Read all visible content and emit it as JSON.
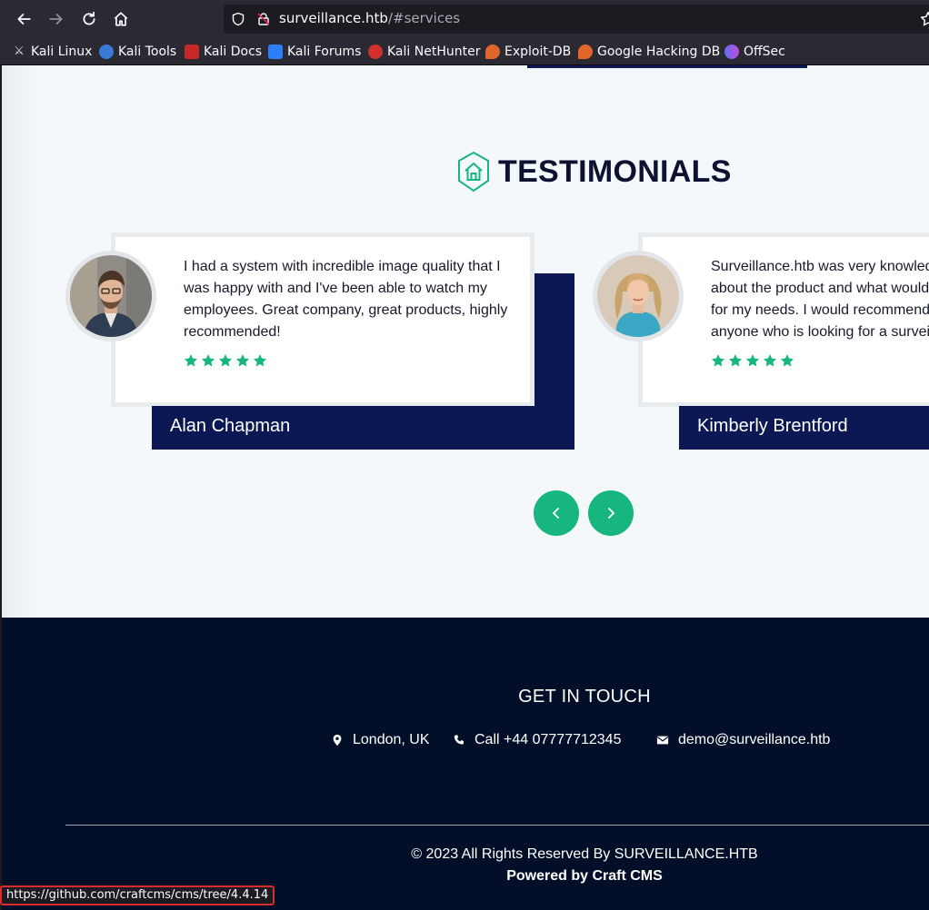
{
  "browser": {
    "url_host": "surveillance.htb",
    "url_path": "/#services",
    "bookmarks": [
      {
        "label": "Kali Linux",
        "icon": "kali-dragon-icon",
        "color": "#1a1a1a"
      },
      {
        "label": "Kali Tools",
        "icon": "kali-tools-icon",
        "color": "#3a7bd5"
      },
      {
        "label": "Kali Docs",
        "icon": "kali-docs-icon",
        "color": "#c62828"
      },
      {
        "label": "Kali Forums",
        "icon": "kali-forums-icon",
        "color": "#2d7ff9"
      },
      {
        "label": "Kali NetHunter",
        "icon": "nethunter-icon",
        "color": "#d32f2f"
      },
      {
        "label": "Exploit-DB",
        "icon": "exploit-db-icon",
        "color": "#e0662c"
      },
      {
        "label": "Google Hacking DB",
        "icon": "ghdb-icon",
        "color": "#e0662c"
      },
      {
        "label": "OffSec",
        "icon": "offsec-icon",
        "color": "#5b6ef5"
      }
    ],
    "status_url": "https://github.com/craftcms/cms/tree/4.4.14"
  },
  "testimonials": {
    "title": "TESTIMONIALS",
    "items": [
      {
        "quote": "I had a system with incredible image quality that I was happy with and I've been able to watch my employees. Great company, great products, highly recommended!",
        "name": "Alan Chapman",
        "rating": 5
      },
      {
        "quote": "Surveillance.htb was very knowledgeable about the product and what would be best for my needs. I would recommend them to anyone who is looking for a surveillance",
        "name": "Kimberly Brentford",
        "rating": 5
      }
    ],
    "prev_label": "previous",
    "next_label": "next"
  },
  "footer": {
    "heading": "GET IN TOUCH",
    "location": "London, UK",
    "phone": "Call +44 07777712345",
    "email": "demo@surveillance.htb",
    "copyright": "© 2023 All Rights Reserved By SURVEILLANCE.HTB",
    "powered": "Powered by Craft CMS"
  },
  "colors": {
    "accent": "#16b67e",
    "navy": "#0b1854",
    "footer_bg": "#030f28",
    "section_bg": "#f4f8fa"
  }
}
